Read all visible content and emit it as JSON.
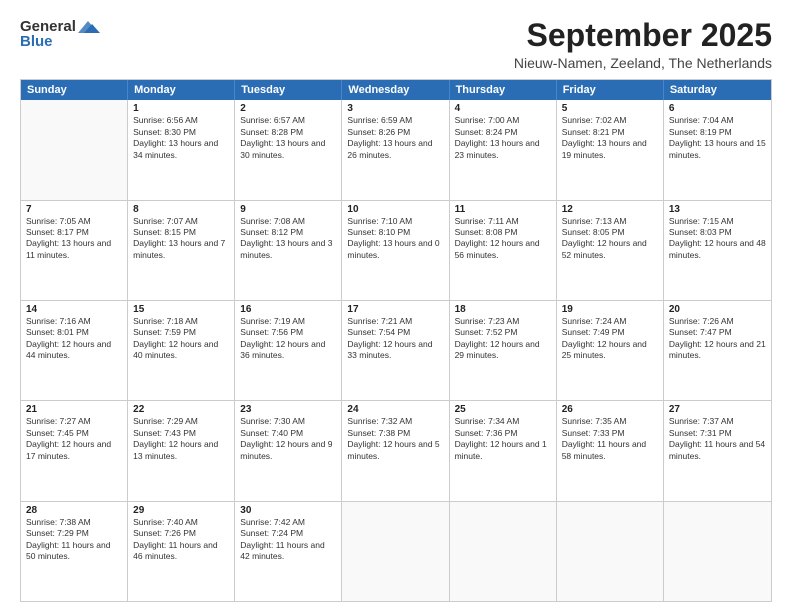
{
  "logo": {
    "general": "General",
    "blue": "Blue"
  },
  "title": "September 2025",
  "location": "Nieuw-Namen, Zeeland, The Netherlands",
  "header_days": [
    "Sunday",
    "Monday",
    "Tuesday",
    "Wednesday",
    "Thursday",
    "Friday",
    "Saturday"
  ],
  "weeks": [
    [
      {
        "day": "",
        "sunrise": "",
        "sunset": "",
        "daylight": ""
      },
      {
        "day": "1",
        "sunrise": "Sunrise: 6:56 AM",
        "sunset": "Sunset: 8:30 PM",
        "daylight": "Daylight: 13 hours and 34 minutes."
      },
      {
        "day": "2",
        "sunrise": "Sunrise: 6:57 AM",
        "sunset": "Sunset: 8:28 PM",
        "daylight": "Daylight: 13 hours and 30 minutes."
      },
      {
        "day": "3",
        "sunrise": "Sunrise: 6:59 AM",
        "sunset": "Sunset: 8:26 PM",
        "daylight": "Daylight: 13 hours and 26 minutes."
      },
      {
        "day": "4",
        "sunrise": "Sunrise: 7:00 AM",
        "sunset": "Sunset: 8:24 PM",
        "daylight": "Daylight: 13 hours and 23 minutes."
      },
      {
        "day": "5",
        "sunrise": "Sunrise: 7:02 AM",
        "sunset": "Sunset: 8:21 PM",
        "daylight": "Daylight: 13 hours and 19 minutes."
      },
      {
        "day": "6",
        "sunrise": "Sunrise: 7:04 AM",
        "sunset": "Sunset: 8:19 PM",
        "daylight": "Daylight: 13 hours and 15 minutes."
      }
    ],
    [
      {
        "day": "7",
        "sunrise": "Sunrise: 7:05 AM",
        "sunset": "Sunset: 8:17 PM",
        "daylight": "Daylight: 13 hours and 11 minutes."
      },
      {
        "day": "8",
        "sunrise": "Sunrise: 7:07 AM",
        "sunset": "Sunset: 8:15 PM",
        "daylight": "Daylight: 13 hours and 7 minutes."
      },
      {
        "day": "9",
        "sunrise": "Sunrise: 7:08 AM",
        "sunset": "Sunset: 8:12 PM",
        "daylight": "Daylight: 13 hours and 3 minutes."
      },
      {
        "day": "10",
        "sunrise": "Sunrise: 7:10 AM",
        "sunset": "Sunset: 8:10 PM",
        "daylight": "Daylight: 13 hours and 0 minutes."
      },
      {
        "day": "11",
        "sunrise": "Sunrise: 7:11 AM",
        "sunset": "Sunset: 8:08 PM",
        "daylight": "Daylight: 12 hours and 56 minutes."
      },
      {
        "day": "12",
        "sunrise": "Sunrise: 7:13 AM",
        "sunset": "Sunset: 8:05 PM",
        "daylight": "Daylight: 12 hours and 52 minutes."
      },
      {
        "day": "13",
        "sunrise": "Sunrise: 7:15 AM",
        "sunset": "Sunset: 8:03 PM",
        "daylight": "Daylight: 12 hours and 48 minutes."
      }
    ],
    [
      {
        "day": "14",
        "sunrise": "Sunrise: 7:16 AM",
        "sunset": "Sunset: 8:01 PM",
        "daylight": "Daylight: 12 hours and 44 minutes."
      },
      {
        "day": "15",
        "sunrise": "Sunrise: 7:18 AM",
        "sunset": "Sunset: 7:59 PM",
        "daylight": "Daylight: 12 hours and 40 minutes."
      },
      {
        "day": "16",
        "sunrise": "Sunrise: 7:19 AM",
        "sunset": "Sunset: 7:56 PM",
        "daylight": "Daylight: 12 hours and 36 minutes."
      },
      {
        "day": "17",
        "sunrise": "Sunrise: 7:21 AM",
        "sunset": "Sunset: 7:54 PM",
        "daylight": "Daylight: 12 hours and 33 minutes."
      },
      {
        "day": "18",
        "sunrise": "Sunrise: 7:23 AM",
        "sunset": "Sunset: 7:52 PM",
        "daylight": "Daylight: 12 hours and 29 minutes."
      },
      {
        "day": "19",
        "sunrise": "Sunrise: 7:24 AM",
        "sunset": "Sunset: 7:49 PM",
        "daylight": "Daylight: 12 hours and 25 minutes."
      },
      {
        "day": "20",
        "sunrise": "Sunrise: 7:26 AM",
        "sunset": "Sunset: 7:47 PM",
        "daylight": "Daylight: 12 hours and 21 minutes."
      }
    ],
    [
      {
        "day": "21",
        "sunrise": "Sunrise: 7:27 AM",
        "sunset": "Sunset: 7:45 PM",
        "daylight": "Daylight: 12 hours and 17 minutes."
      },
      {
        "day": "22",
        "sunrise": "Sunrise: 7:29 AM",
        "sunset": "Sunset: 7:43 PM",
        "daylight": "Daylight: 12 hours and 13 minutes."
      },
      {
        "day": "23",
        "sunrise": "Sunrise: 7:30 AM",
        "sunset": "Sunset: 7:40 PM",
        "daylight": "Daylight: 12 hours and 9 minutes."
      },
      {
        "day": "24",
        "sunrise": "Sunrise: 7:32 AM",
        "sunset": "Sunset: 7:38 PM",
        "daylight": "Daylight: 12 hours and 5 minutes."
      },
      {
        "day": "25",
        "sunrise": "Sunrise: 7:34 AM",
        "sunset": "Sunset: 7:36 PM",
        "daylight": "Daylight: 12 hours and 1 minute."
      },
      {
        "day": "26",
        "sunrise": "Sunrise: 7:35 AM",
        "sunset": "Sunset: 7:33 PM",
        "daylight": "Daylight: 11 hours and 58 minutes."
      },
      {
        "day": "27",
        "sunrise": "Sunrise: 7:37 AM",
        "sunset": "Sunset: 7:31 PM",
        "daylight": "Daylight: 11 hours and 54 minutes."
      }
    ],
    [
      {
        "day": "28",
        "sunrise": "Sunrise: 7:38 AM",
        "sunset": "Sunset: 7:29 PM",
        "daylight": "Daylight: 11 hours and 50 minutes."
      },
      {
        "day": "29",
        "sunrise": "Sunrise: 7:40 AM",
        "sunset": "Sunset: 7:26 PM",
        "daylight": "Daylight: 11 hours and 46 minutes."
      },
      {
        "day": "30",
        "sunrise": "Sunrise: 7:42 AM",
        "sunset": "Sunset: 7:24 PM",
        "daylight": "Daylight: 11 hours and 42 minutes."
      },
      {
        "day": "",
        "sunrise": "",
        "sunset": "",
        "daylight": ""
      },
      {
        "day": "",
        "sunrise": "",
        "sunset": "",
        "daylight": ""
      },
      {
        "day": "",
        "sunrise": "",
        "sunset": "",
        "daylight": ""
      },
      {
        "day": "",
        "sunrise": "",
        "sunset": "",
        "daylight": ""
      }
    ]
  ]
}
